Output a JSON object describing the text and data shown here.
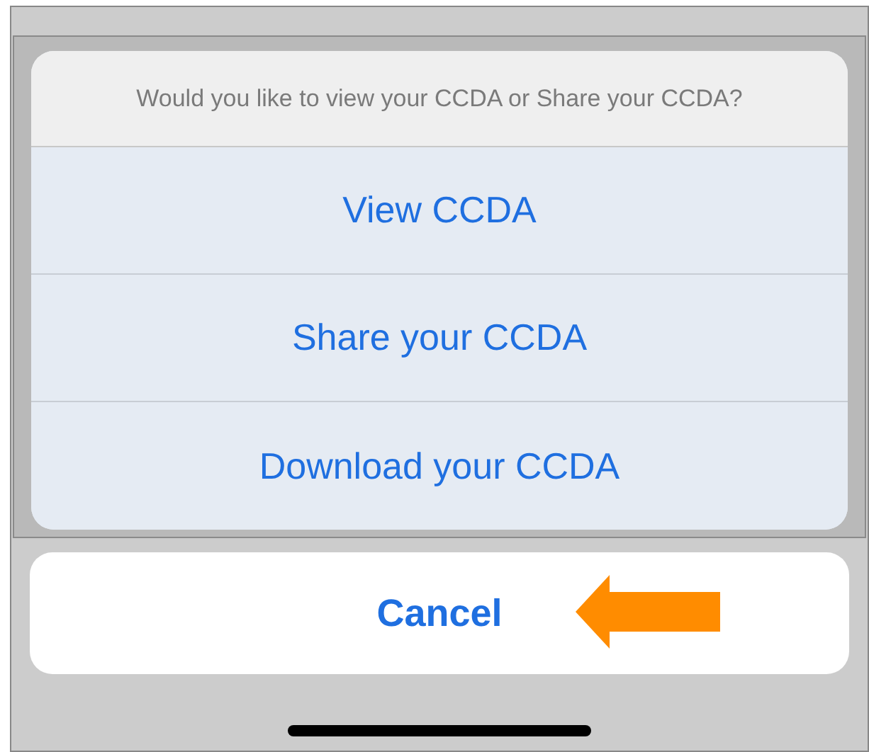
{
  "action_sheet": {
    "message": "Would you like to view your CCDA or Share your CCDA?",
    "actions": [
      {
        "label": "View CCDA"
      },
      {
        "label": "Share your CCDA"
      },
      {
        "label": "Download your CCDA"
      }
    ]
  },
  "cancel_button": {
    "label": "Cancel"
  }
}
